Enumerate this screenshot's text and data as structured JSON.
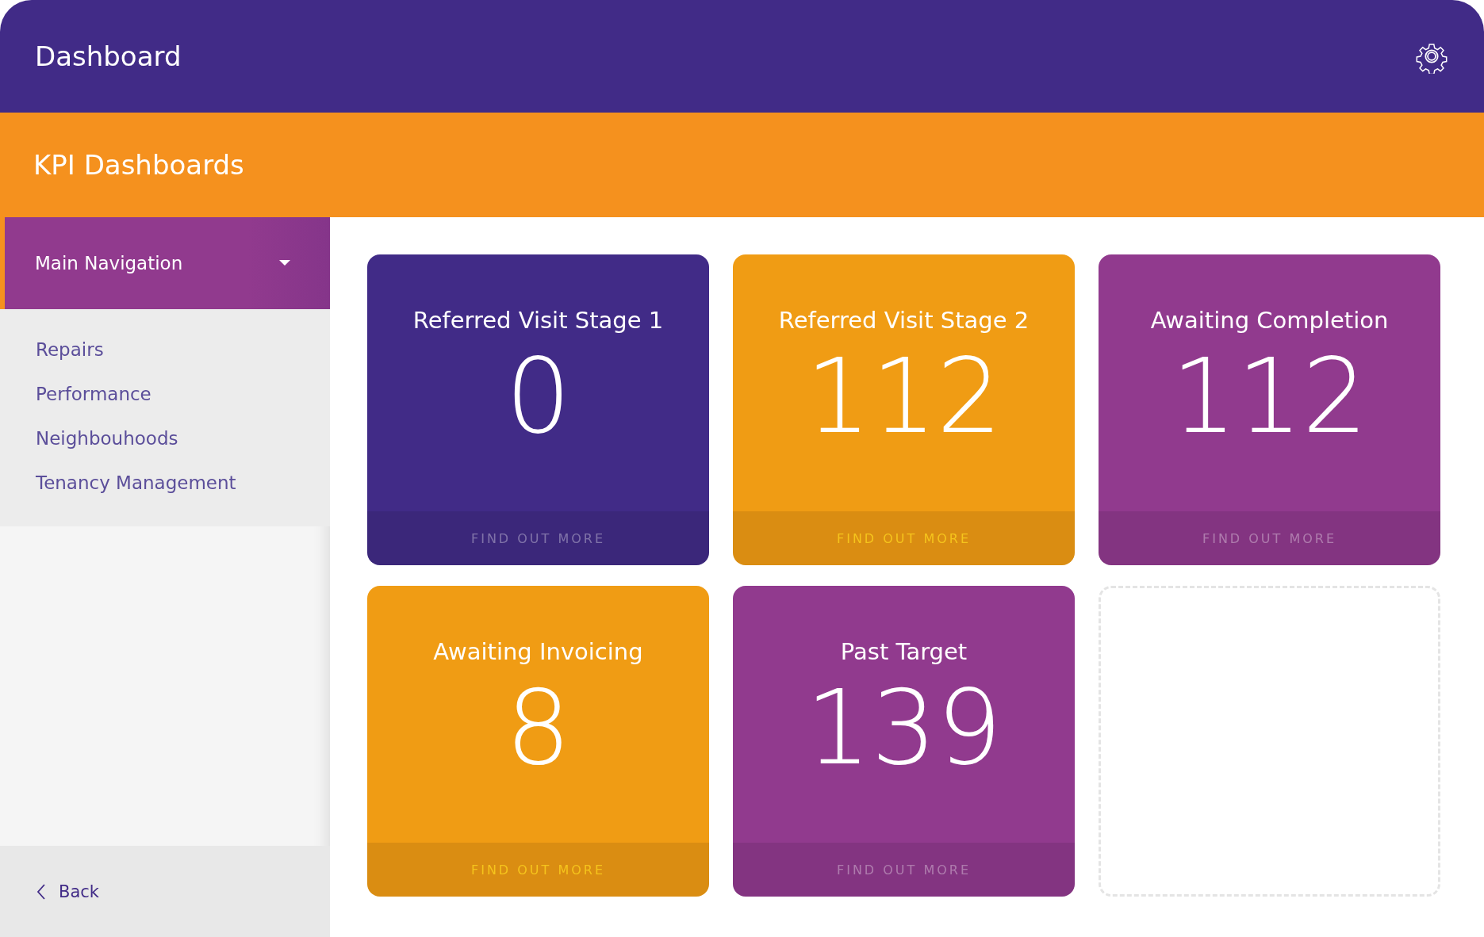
{
  "window": {
    "title": "Dashboard"
  },
  "banner": {
    "title": "KPI Dashboards"
  },
  "sidebar": {
    "nav_header": {
      "label": "Main Navigation",
      "expanded": true
    },
    "items": [
      {
        "label": "Repairs"
      },
      {
        "label": "Performance"
      },
      {
        "label": "Neighbouhoods"
      },
      {
        "label": "Tenancy Management"
      }
    ],
    "back": {
      "label": "Back"
    }
  },
  "cards": [
    {
      "title": "Referred Visit Stage 1",
      "value": "0",
      "link": "FIND OUT MORE",
      "color": "#412b87",
      "kind": "cool"
    },
    {
      "title": "Referred Visit Stage 2",
      "value": "112",
      "link": "FIND OUT MORE",
      "color": "#f09c14",
      "kind": "warm"
    },
    {
      "title": "Awaiting Completion",
      "value": "112",
      "link": "FIND OUT MORE",
      "color": "#913a8e",
      "kind": "cool"
    },
    {
      "title": "Awaiting Invoicing",
      "value": "8",
      "link": "FIND OUT MORE",
      "color": "#f09c14",
      "kind": "warm"
    },
    {
      "title": "Past Target",
      "value": "139",
      "link": "FIND OUT MORE",
      "color": "#913a8e",
      "kind": "cool"
    }
  ]
}
